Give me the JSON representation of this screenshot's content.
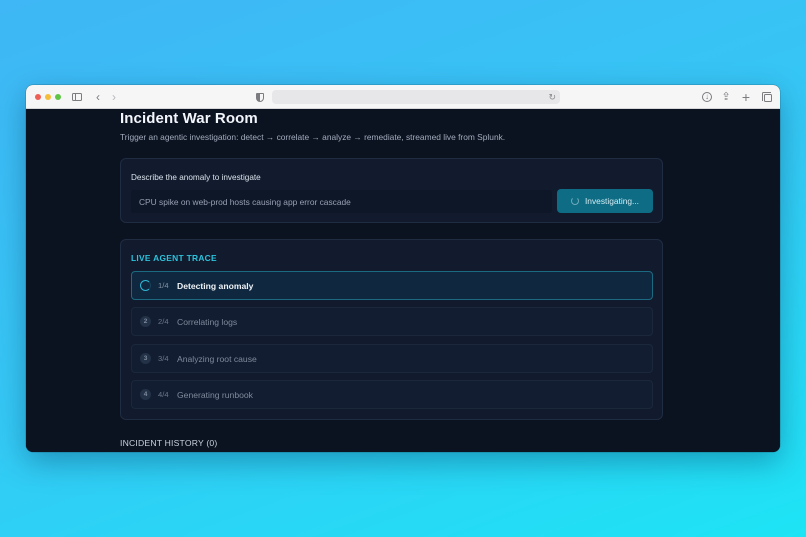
{
  "browser": {
    "icons": [
      "sidebar-icon",
      "back-icon",
      "forward-icon",
      "shield-icon",
      "reload-icon",
      "download-icon",
      "share-icon",
      "plus-icon",
      "tabs-icon"
    ]
  },
  "page": {
    "title": "Incident War Room",
    "subtitle": "Trigger an agentic investigation: detect → correlate → analyze → remediate, streamed live from Splunk."
  },
  "form": {
    "label": "Describe the anomaly to investigate",
    "input_value": "CPU spike on web-prod hosts causing app error cascade",
    "button_label": "Investigating..."
  },
  "trace": {
    "heading": "LIVE AGENT TRACE",
    "steps": [
      {
        "badge": "",
        "count": "1/4",
        "name": "Detecting anomaly",
        "status": "active"
      },
      {
        "badge": "2",
        "count": "2/4",
        "name": "Correlating logs",
        "status": "pending"
      },
      {
        "badge": "3",
        "count": "3/4",
        "name": "Analyzing root cause",
        "status": "pending"
      },
      {
        "badge": "4",
        "count": "4/4",
        "name": "Generating runbook",
        "status": "pending"
      }
    ]
  },
  "history": {
    "heading": "INCIDENT HISTORY (0)"
  },
  "colors": {
    "accent": "#2cc3dd",
    "button": "#0e6c84",
    "background": "#0b1220"
  }
}
